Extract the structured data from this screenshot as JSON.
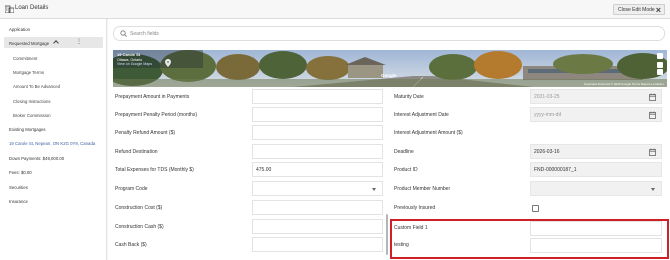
{
  "header": {
    "title": "Loan Details",
    "close_edit_label": "Close Edit Mode"
  },
  "sidebar": {
    "items": [
      {
        "label": "Application"
      },
      {
        "label": "Requested Mortgage"
      },
      {
        "label": "Commitment"
      },
      {
        "label": "Mortgage Terms"
      },
      {
        "label": "Amount To Be Advanced"
      },
      {
        "label": "Closing Instructions"
      },
      {
        "label": "Broker Commission"
      },
      {
        "label": "Existing Mortgages"
      },
      {
        "label": "19 Carole St, Nepean, ON K2G 0Y9, Canada"
      },
      {
        "label": "Down Payments: $49,000.00"
      },
      {
        "label": "Fees: $0.00"
      },
      {
        "label": "Securities"
      },
      {
        "label": "Insurance"
      }
    ]
  },
  "search": {
    "placeholder": "Search fields",
    "value": ""
  },
  "map": {
    "address_line1": "19 Carole St",
    "address_line2": "Ottawa, Ontario",
    "address_line3": "View on Google Maps",
    "brand": "Google",
    "footer": "Keyboard shortcuts  © 2026 Google  Terms  Report a problem"
  },
  "left_fields": [
    {
      "label": "Prepayment Amount in Payments",
      "value": ""
    },
    {
      "label": "Prepayment Penalty Period (months)",
      "value": ""
    },
    {
      "label": "Penalty Refund Amount ($)",
      "value": ""
    },
    {
      "label": "Refund Destination",
      "value": ""
    },
    {
      "label": "Total Expenses for TDS (Monthly $)",
      "value": "475.00"
    },
    {
      "label": "Program Code",
      "value": ""
    },
    {
      "label": "Construction Cost ($)",
      "value": ""
    },
    {
      "label": "Construction Cash ($)",
      "value": ""
    },
    {
      "label": "Cash Back ($)",
      "value": ""
    }
  ],
  "right_fields": [
    {
      "label": "Maturity Date",
      "value": "2031-03-25"
    },
    {
      "label": "Interest Adjustment Date",
      "value": "",
      "placeholder": "yyyy-mm-dd"
    },
    {
      "label": "Interest Adjustment Amount ($)",
      "value": ""
    },
    {
      "label": "Deadline",
      "value": "2026-03-16"
    },
    {
      "label": "Product ID",
      "value": "FND-000000187_1"
    },
    {
      "label": "Product Member Number",
      "value": ""
    },
    {
      "label": "Previously Insured",
      "value": ""
    },
    {
      "label": "Custom Field 1",
      "value": ""
    },
    {
      "label": "testing",
      "value": ""
    }
  ],
  "colors": {
    "highlight": "#d01f25",
    "link": "#3a5fa8"
  }
}
